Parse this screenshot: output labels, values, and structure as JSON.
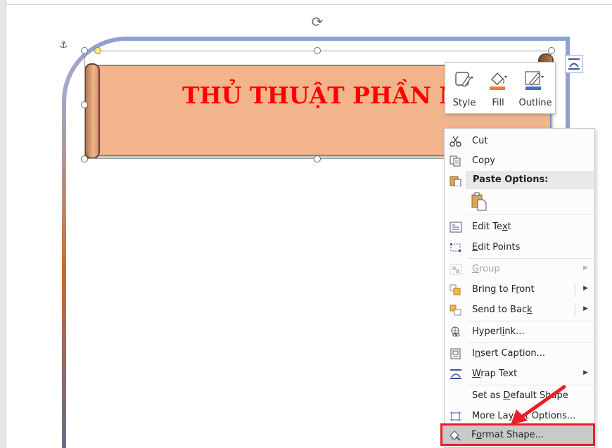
{
  "document": {
    "banner_title": "THỦ THUẬT PHẦN M"
  },
  "mini_toolbar": {
    "style_label": "Style",
    "fill_label": "Fill",
    "outline_label": "Outline",
    "fill_color": "#ed7d31",
    "outline_color": "#4472c4"
  },
  "context_menu": {
    "cut": "Cut",
    "copy": "Copy",
    "paste_options": "Paste Options:",
    "edit_text": "Edit Text",
    "edit_points": "Edit Points",
    "group": "Group",
    "bring_to_front": "Bring to Front",
    "send_to_back": "Send to Back",
    "hyperlink": "Hyperlink...",
    "insert_caption": "Insert Caption...",
    "wrap_text": "Wrap Text",
    "set_default": "Set as Default Shape",
    "more_layout": "More Layout Options...",
    "format_shape": "Format Shape..."
  },
  "colors": {
    "highlight": "#ee1c24",
    "title_text": "#ff0000",
    "banner_fill": "#f2b48a",
    "frame": "#8fa1d0"
  }
}
